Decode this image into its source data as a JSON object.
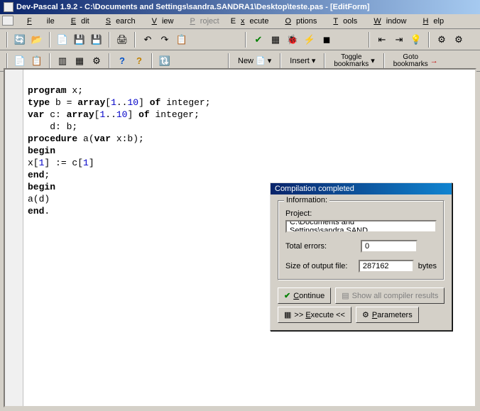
{
  "title": "Dev-Pascal 1.9.2 - C:\\Documents and Settings\\sandra.SANDRA1\\Desktop\\teste.pas - [EditForm]",
  "menu": {
    "file": "File",
    "edit": "Edit",
    "search": "Search",
    "view": "View",
    "project": "Project",
    "execute": "Execute",
    "options": "Options",
    "tools": "Tools",
    "window": "Window",
    "help": "Help"
  },
  "toolbar2": {
    "new": "New",
    "insert": "Insert",
    "toggle_bookmarks": "Toggle\nbookmarks",
    "goto_bookmarks": "Goto\nbookmarks"
  },
  "code": {
    "l1a": "program",
    "l1b": " x;",
    "l2a": "type",
    "l2b": " b = ",
    "l2c": "array",
    "l2d": "[",
    "l2e": "1",
    "l2f": "..",
    "l2g": "10",
    "l2h": "] ",
    "l2i": "of",
    "l2j": " integer;",
    "l3a": "var",
    "l3b": " c: ",
    "l3c": "array",
    "l3d": "[",
    "l3e": "1",
    "l3f": "..",
    "l3g": "10",
    "l3h": "] ",
    "l3i": "of",
    "l3j": " integer;",
    "l4": "    d: b;",
    "l5a": "procedure",
    "l5b": " a(",
    "l5c": "var",
    "l5d": " x:b);",
    "l6": "begin",
    "l7a": "x[",
    "l7b": "1",
    "l7c": "] := c[",
    "l7d": "1",
    "l7e": "]",
    "l8": "end",
    "l8b": ";",
    "l9": "begin",
    "l10": "a(d)",
    "l11": "end",
    "l11b": "."
  },
  "dialog": {
    "title": "Compilation completed",
    "info_legend": "Information:",
    "project_label": "Project:",
    "project_path": "C:\\Documents and Settings\\sandra.SAND",
    "errors_label": "Total errors:",
    "errors_value": "0",
    "size_label": "Size of output file:",
    "size_value": "287162",
    "size_unit": "bytes",
    "continue": "Continue",
    "show_all": "Show all compiler results",
    "execute": ">> Execute <<",
    "parameters": "Parameters"
  }
}
